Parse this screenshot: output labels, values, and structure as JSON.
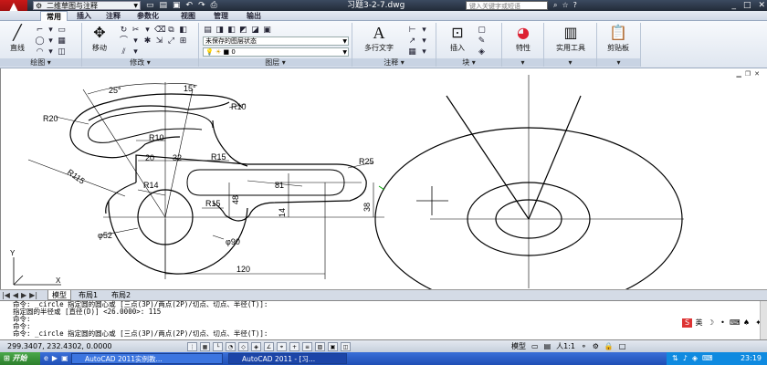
{
  "titlebar": {
    "workspace": "二维草图与注释",
    "qat_icons": [
      "new-icon",
      "open-icon",
      "save-icon",
      "undo-icon",
      "redo-icon",
      "print-icon"
    ],
    "title": "习题3-2-7.dwg",
    "search_placeholder": "键入关键字或短语",
    "window_buttons": [
      "minimize",
      "maximize",
      "close"
    ]
  },
  "tabs": [
    {
      "label": "常用",
      "active": true
    },
    {
      "label": "插入"
    },
    {
      "label": "注释"
    },
    {
      "label": "参数化"
    },
    {
      "label": "视图"
    },
    {
      "label": "管理"
    },
    {
      "label": "输出"
    }
  ],
  "ribbon": {
    "panels": {
      "draw": "绘图",
      "modify": "修改",
      "layers": "图层",
      "annotation": "注释",
      "block": "块"
    },
    "buttons": {
      "line": "直线",
      "move": "移动",
      "mtext": "多行文字",
      "insert": "插入",
      "properties": "特性",
      "utilities": "实用工具",
      "clipboard": "剪贴板"
    },
    "layer_state": "未保存的图层状态",
    "layer_current": "0"
  },
  "drawing": {
    "dims": {
      "angle1": "25°",
      "angle2": "15°",
      "r10_top": "R10",
      "r20": "R20",
      "r10_mid": "R10",
      "r115": "R115",
      "d20": "20",
      "d32": "32",
      "r15_top": "R15",
      "r25": "R25",
      "r14": "R14",
      "d48": "48",
      "r15_bot": "R15",
      "d81": "81",
      "d14": "14",
      "d38": "38",
      "dia52": "φ52",
      "dia90": "φ90",
      "d120": "120"
    }
  },
  "layout_tabs": [
    {
      "label": "模型",
      "active": true
    },
    {
      "label": "布局1"
    },
    {
      "label": "布局2"
    }
  ],
  "command": {
    "lines": [
      "命令: _circle 指定圆的圆心或 [三点(3P)/两点(2P)/切点、切点、半径(T)]:",
      "指定圆的半径或 [直径(D)] <26.0000>: 115",
      "命令:",
      "命令:",
      "命令: _circle 指定圆的圆心或 [三点(3P)/两点(2P)/切点、切点、半径(T)]:"
    ],
    "ime": "英"
  },
  "status": {
    "coords": "299.3407, 232.4302, 0.0000",
    "model": "模型",
    "scale": "人1:1"
  },
  "taskbar": {
    "start": "开始",
    "tasks": [
      "AutoCAD 2011实例教...",
      "AutoCAD 2011 - [习..."
    ],
    "clock": "23:19"
  }
}
